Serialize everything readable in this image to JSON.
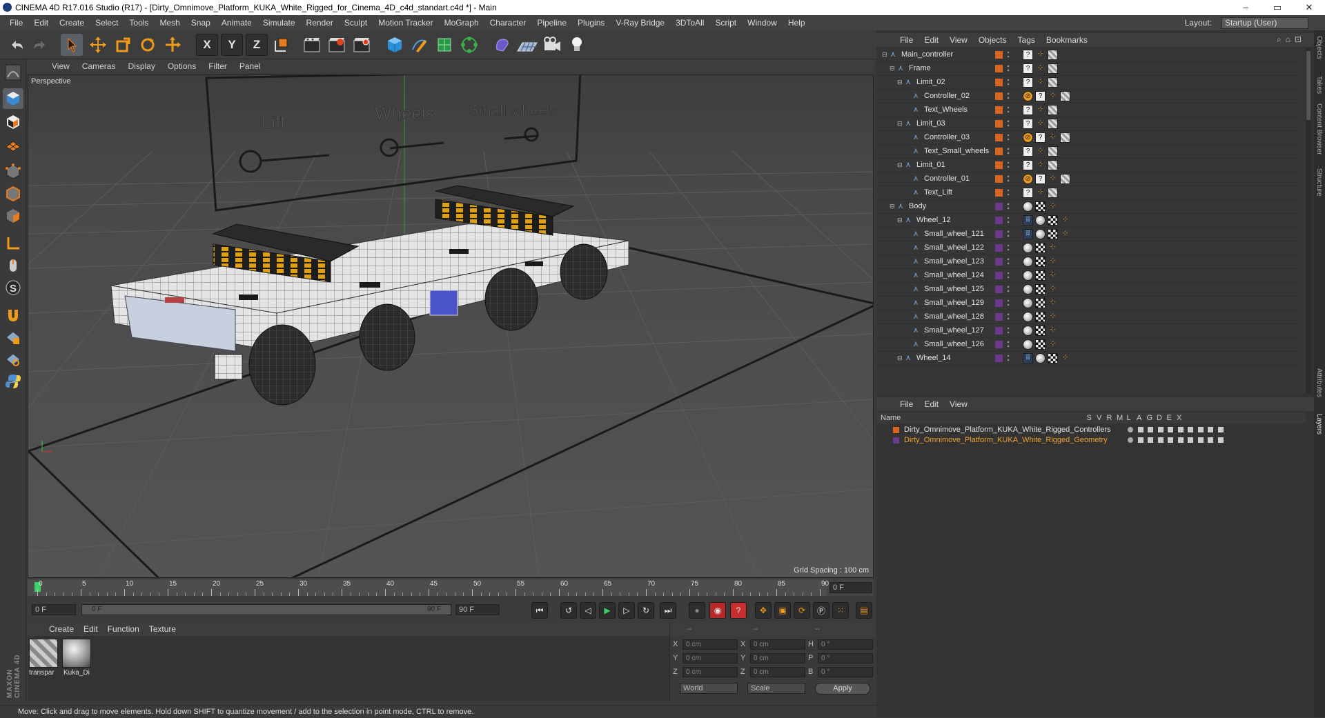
{
  "window": {
    "title": "CINEMA 4D R17.016 Studio (R17) - [Dirty_Omnimove_Platform_KUKA_White_Rigged_for_Cinema_4D_c4d_standart.c4d *] - Main",
    "minimize": "–",
    "maximize": "▭",
    "close": "✕"
  },
  "menubar": {
    "items": [
      "File",
      "Edit",
      "Create",
      "Select",
      "Tools",
      "Mesh",
      "Snap",
      "Animate",
      "Simulate",
      "Render",
      "Sculpt",
      "Motion Tracker",
      "MoGraph",
      "Character",
      "Pipeline",
      "Plugins",
      "V-Ray Bridge",
      "3DToAll",
      "Script",
      "Window",
      "Help"
    ],
    "layout_label": "Layout:",
    "layout_value": "Startup (User)"
  },
  "toolbar": {
    "icons": [
      "undo-icon",
      "redo-icon",
      "live-selection-icon",
      "move-icon",
      "scale-icon",
      "rotate-icon",
      "last-tool-icon",
      "x-axis-icon",
      "y-axis-icon",
      "z-axis-icon",
      "coordinate-system-icon",
      "render-view-icon",
      "render-picture-viewer-icon",
      "edit-render-settings-icon",
      "cube-icon",
      "pen-icon",
      "subdivision-icon",
      "array-icon",
      "deformer-icon",
      "floor-icon",
      "camera-icon",
      "light-icon"
    ],
    "axis_x": "X",
    "axis_y": "Y",
    "axis_z": "Z"
  },
  "viewport": {
    "menu": [
      "View",
      "Cameras",
      "Display",
      "Options",
      "Filter",
      "Panel"
    ],
    "label": "Perspective",
    "grid_spacing": "Grid Spacing : 100 cm",
    "scene_text": [
      "Lift",
      "Wheels",
      "Small wheels"
    ]
  },
  "timeline": {
    "ticks": [
      "0",
      "5",
      "10",
      "15",
      "20",
      "25",
      "30",
      "35",
      "40",
      "45",
      "50",
      "55",
      "60",
      "65",
      "70",
      "75",
      "80",
      "85",
      "90"
    ],
    "current_frame": "0 F",
    "start_field": "0 F",
    "range_start": "0 F",
    "range_end": "90 F",
    "end_field": "90 F"
  },
  "material_manager": {
    "menu": [
      "Create",
      "Edit",
      "Function",
      "Texture"
    ],
    "materials": [
      {
        "name": "transpar"
      },
      {
        "name": "Kuka_Di"
      }
    ]
  },
  "coordinates": {
    "header": [
      "--",
      "--",
      "--"
    ],
    "rows": [
      {
        "a": "X",
        "av": "0 cm",
        "b": "X",
        "bv": "0 cm",
        "c": "H",
        "cv": "0 °"
      },
      {
        "a": "Y",
        "av": "0 cm",
        "b": "Y",
        "bv": "0 cm",
        "c": "P",
        "cv": "0 °"
      },
      {
        "a": "Z",
        "av": "0 cm",
        "b": "Z",
        "bv": "0 cm",
        "c": "B",
        "cv": "0 °"
      }
    ],
    "mode": "World",
    "transform": "Scale",
    "apply": "Apply"
  },
  "status": "Move: Click and drag to move elements. Hold down SHIFT to quantize movement / add to the selection in point mode, CTRL to remove.",
  "object_manager": {
    "menu": [
      "File",
      "Edit",
      "View",
      "Objects",
      "Tags",
      "Bookmarks"
    ],
    "objects": [
      {
        "name": "Main_controller",
        "depth": 0,
        "expand": "−",
        "layer": "#d9661e",
        "tags": [
          "?",
          "orange",
          "check"
        ]
      },
      {
        "name": "Frame",
        "depth": 1,
        "expand": "−",
        "layer": "#d9661e",
        "tags": [
          "?",
          "orange",
          "check"
        ]
      },
      {
        "name": "Limit_02",
        "depth": 2,
        "expand": "−",
        "layer": "#d9661e",
        "tags": [
          "?",
          "orange",
          "check"
        ]
      },
      {
        "name": "Controller_02",
        "depth": 3,
        "expand": "",
        "layer": "#d9661e",
        "tags": [
          "prot",
          "?",
          "orange",
          "check"
        ]
      },
      {
        "name": "Text_Wheels",
        "depth": 3,
        "expand": "",
        "layer": "#d9661e",
        "tags": [
          "?",
          "orange",
          "check"
        ]
      },
      {
        "name": "Limit_03",
        "depth": 2,
        "expand": "−",
        "layer": "#d9661e",
        "tags": [
          "?",
          "orange",
          "check"
        ]
      },
      {
        "name": "Controller_03",
        "depth": 3,
        "expand": "",
        "layer": "#d9661e",
        "tags": [
          "prot",
          "?",
          "orange",
          "check"
        ]
      },
      {
        "name": "Text_Small_wheels",
        "depth": 3,
        "expand": "",
        "layer": "#d9661e",
        "tags": [
          "?",
          "orange",
          "check"
        ]
      },
      {
        "name": "Limit_01",
        "depth": 2,
        "expand": "−",
        "layer": "#d9661e",
        "tags": [
          "?",
          "orange",
          "check"
        ]
      },
      {
        "name": "Controller_01",
        "depth": 3,
        "expand": "",
        "layer": "#d9661e",
        "tags": [
          "prot",
          "?",
          "orange",
          "check"
        ]
      },
      {
        "name": "Text_Lift",
        "depth": 3,
        "expand": "",
        "layer": "#d9661e",
        "tags": [
          "?",
          "orange",
          "check"
        ]
      },
      {
        "name": "Body",
        "depth": 1,
        "expand": "−",
        "layer": "#6b3a8c",
        "tags": [
          "sphere",
          "checker",
          "orange"
        ]
      },
      {
        "name": "Wheel_12",
        "depth": 2,
        "expand": "−",
        "layer": "#6b3a8c",
        "tags": [
          "dots",
          "sphere",
          "checker",
          "orange"
        ]
      },
      {
        "name": "Small_wheel_121",
        "depth": 3,
        "expand": "",
        "layer": "#6b3a8c",
        "tags": [
          "dots",
          "sphere",
          "checker",
          "orange"
        ]
      },
      {
        "name": "Small_wheel_122",
        "depth": 3,
        "expand": "",
        "layer": "#6b3a8c",
        "tags": [
          "sphere",
          "checker",
          "orange"
        ]
      },
      {
        "name": "Small_wheel_123",
        "depth": 3,
        "expand": "",
        "layer": "#6b3a8c",
        "tags": [
          "sphere",
          "checker",
          "orange"
        ]
      },
      {
        "name": "Small_wheel_124",
        "depth": 3,
        "expand": "",
        "layer": "#6b3a8c",
        "tags": [
          "sphere",
          "checker",
          "orange"
        ]
      },
      {
        "name": "Small_wheel_125",
        "depth": 3,
        "expand": "",
        "layer": "#6b3a8c",
        "tags": [
          "sphere",
          "checker",
          "orange"
        ]
      },
      {
        "name": "Small_wheel_129",
        "depth": 3,
        "expand": "",
        "layer": "#6b3a8c",
        "tags": [
          "sphere",
          "checker",
          "orange"
        ]
      },
      {
        "name": "Small_wheel_128",
        "depth": 3,
        "expand": "",
        "layer": "#6b3a8c",
        "tags": [
          "sphere",
          "checker",
          "orange"
        ]
      },
      {
        "name": "Small_wheel_127",
        "depth": 3,
        "expand": "",
        "layer": "#6b3a8c",
        "tags": [
          "sphere",
          "checker",
          "orange"
        ]
      },
      {
        "name": "Small_wheel_126",
        "depth": 3,
        "expand": "",
        "layer": "#6b3a8c",
        "tags": [
          "sphere",
          "checker",
          "orange"
        ]
      },
      {
        "name": "Wheel_14",
        "depth": 2,
        "expand": "−",
        "layer": "#6b3a8c",
        "tags": [
          "dots",
          "sphere",
          "checker",
          "orange"
        ]
      }
    ]
  },
  "layer_manager": {
    "menu": [
      "File",
      "Edit",
      "View"
    ],
    "columns": [
      "Name",
      "S",
      "V",
      "R",
      "M",
      "L",
      "A",
      "G",
      "D",
      "E",
      "X"
    ],
    "layers": [
      {
        "name": "Dirty_Omnimove_Platform_KUKA_White_Rigged_Controllers",
        "color": "#d9661e",
        "text_color": "#e4e4e4"
      },
      {
        "name": "Dirty_Omnimove_Platform_KUKA_White_Rigged_Geometry",
        "color": "#6b3a8c",
        "text_color": "#f0a030"
      }
    ]
  },
  "side_tabs": [
    "Objects",
    "Takes",
    "Content Browser",
    "Structure",
    "Attributes",
    "Layers"
  ],
  "brand": "MAXON CINEMA 4D"
}
